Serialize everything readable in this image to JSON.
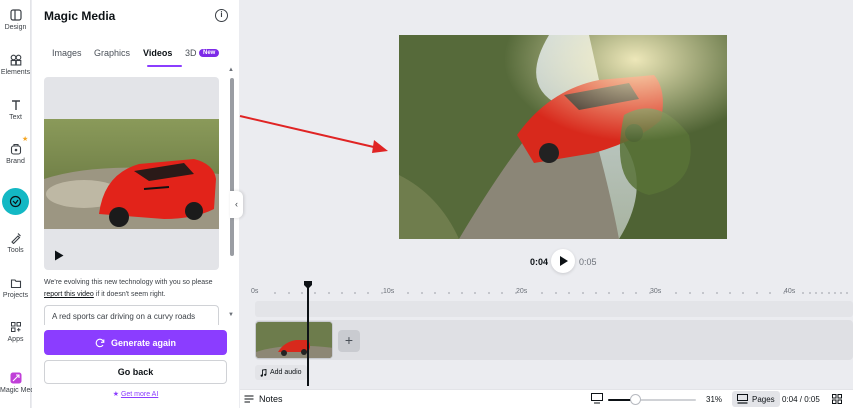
{
  "rail": {
    "items": [
      {
        "label": "Design",
        "icon": "design-icon"
      },
      {
        "label": "Elements",
        "icon": "elements-icon"
      },
      {
        "label": "Text",
        "icon": "text-icon"
      },
      {
        "label": "Brand",
        "icon": "brand-icon"
      },
      {
        "label": "",
        "icon": "magic-media-active-icon"
      },
      {
        "label": "Tools",
        "icon": "tools-icon"
      },
      {
        "label": "Projects",
        "icon": "projects-icon"
      },
      {
        "label": "Apps",
        "icon": "apps-icon"
      },
      {
        "label": "Magic Media",
        "icon": "magic-media-icon"
      }
    ]
  },
  "panel": {
    "title": "Magic Media",
    "tabs": [
      {
        "label": "Images"
      },
      {
        "label": "Graphics"
      },
      {
        "label": "Videos"
      },
      {
        "label": "3D"
      }
    ],
    "new_badge": "New",
    "note_text": "We're evolving this new technology with you so please",
    "note_link": "report this video",
    "note_tail": " if it doesn't seem right.",
    "prompt": "A red sports car driving on a curvy roads",
    "generate_again": "Generate again",
    "go_back": "Go back",
    "get_more_ai": "Get more AI"
  },
  "player": {
    "current": "0:04",
    "duration": "0:05"
  },
  "timeline": {
    "ticks": [
      "0s",
      "10s",
      "20s",
      "30s",
      "40s"
    ],
    "add_audio": "Add audio"
  },
  "bottombar": {
    "notes": "Notes",
    "zoom": "31%",
    "zoom_fraction": 0.31,
    "pages": "Pages",
    "page_time": "0:04 / 0:05"
  },
  "colors": {
    "accent": "#8b3dff",
    "active_rail": "#13b8c4",
    "annotation_arrow": "#e02424"
  }
}
